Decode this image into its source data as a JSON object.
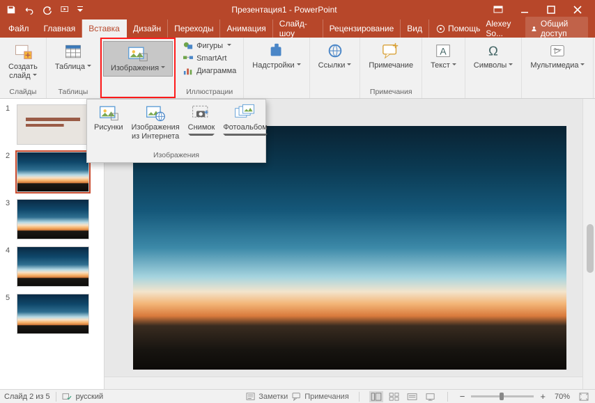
{
  "titlebar": {
    "title": "Презентация1 - PowerPoint"
  },
  "tabs": {
    "file": "Файл",
    "items": [
      "Главная",
      "Вставка",
      "Дизайн",
      "Переходы",
      "Анимация",
      "Слайд-шоу",
      "Рецензирование",
      "Вид"
    ],
    "active_index": 1,
    "help": "Помощь",
    "user": "Alexey So...",
    "share": "Общий доступ"
  },
  "ribbon": {
    "groups": {
      "slides": {
        "label": "Слайды",
        "new_slide": "Создать\nслайд"
      },
      "tables": {
        "label": "Таблицы",
        "table": "Таблица"
      },
      "images": {
        "label": "Изображения",
        "images_btn": "Изображения"
      },
      "illustrations": {
        "label": "Иллюстрации",
        "shapes": "Фигуры",
        "smartart": "SmartArt",
        "chart": "Диаграмма"
      },
      "addins": {
        "label": " ",
        "addins": "Надстройки"
      },
      "links": {
        "label": " ",
        "links": "Ссылки"
      },
      "comments": {
        "label": "Примечания",
        "comment": "Примечание"
      },
      "text": {
        "label": " ",
        "text": "Текст"
      },
      "symbols": {
        "label": " ",
        "symbols": "Символы"
      },
      "media": {
        "label": " ",
        "media": "Мультимедиа"
      }
    }
  },
  "dropdown": {
    "group_label": "Изображения",
    "pictures": "Рисунки",
    "online_top": "Изображения",
    "online_bottom": "из Интернета",
    "screenshot": "Снимок",
    "photoalbum": "Фотоальбом"
  },
  "thumbnails": {
    "count": 5,
    "selected": 2
  },
  "status": {
    "slide_counter": "Слайд 2 из 5",
    "language": "русский",
    "notes": "Заметки",
    "comments": "Примечания",
    "zoom": "70%"
  }
}
